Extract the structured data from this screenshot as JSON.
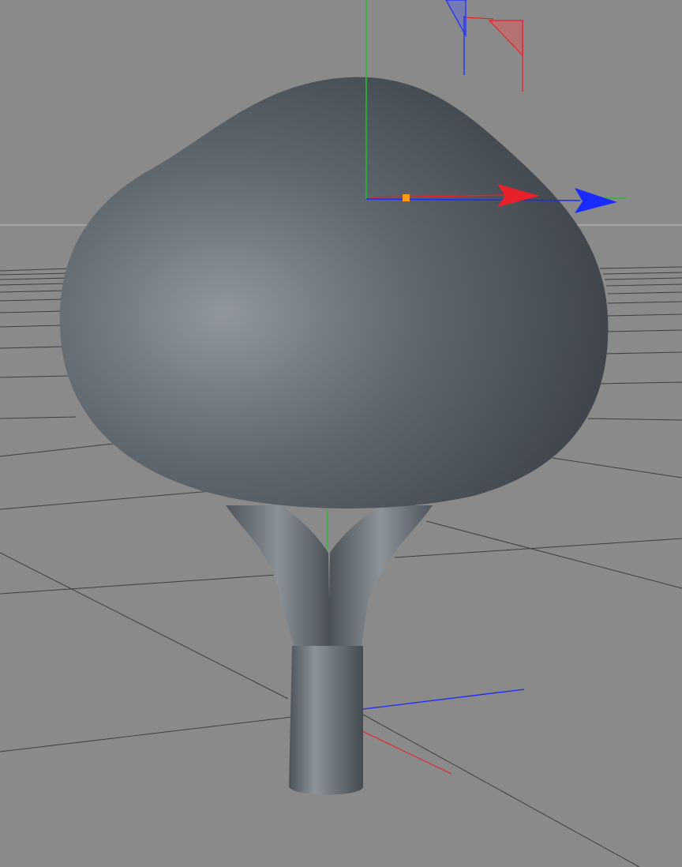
{
  "viewport": {
    "background_color": "#8a8a8a",
    "grid_color": "#3f3f3f",
    "horizon_color": "#b4b4b4"
  },
  "scene": {
    "object": "tree",
    "parts": [
      "canopy",
      "branch-left",
      "branch-right",
      "trunk"
    ],
    "material_color": "#6f767d"
  },
  "gizmos": {
    "axis_colors": {
      "x": "#e8202a",
      "y": "#22c02a",
      "z": "#1a2bff"
    },
    "handle_color": "#ff9a1a",
    "move_gizmo": {
      "icons": [
        "x-arrow-icon",
        "z-arrow-icon",
        "y-axis-line",
        "handle-square"
      ]
    },
    "world_axis": {
      "icons": [
        "world-x-axis",
        "world-z-axis",
        "world-y-axis"
      ]
    }
  }
}
